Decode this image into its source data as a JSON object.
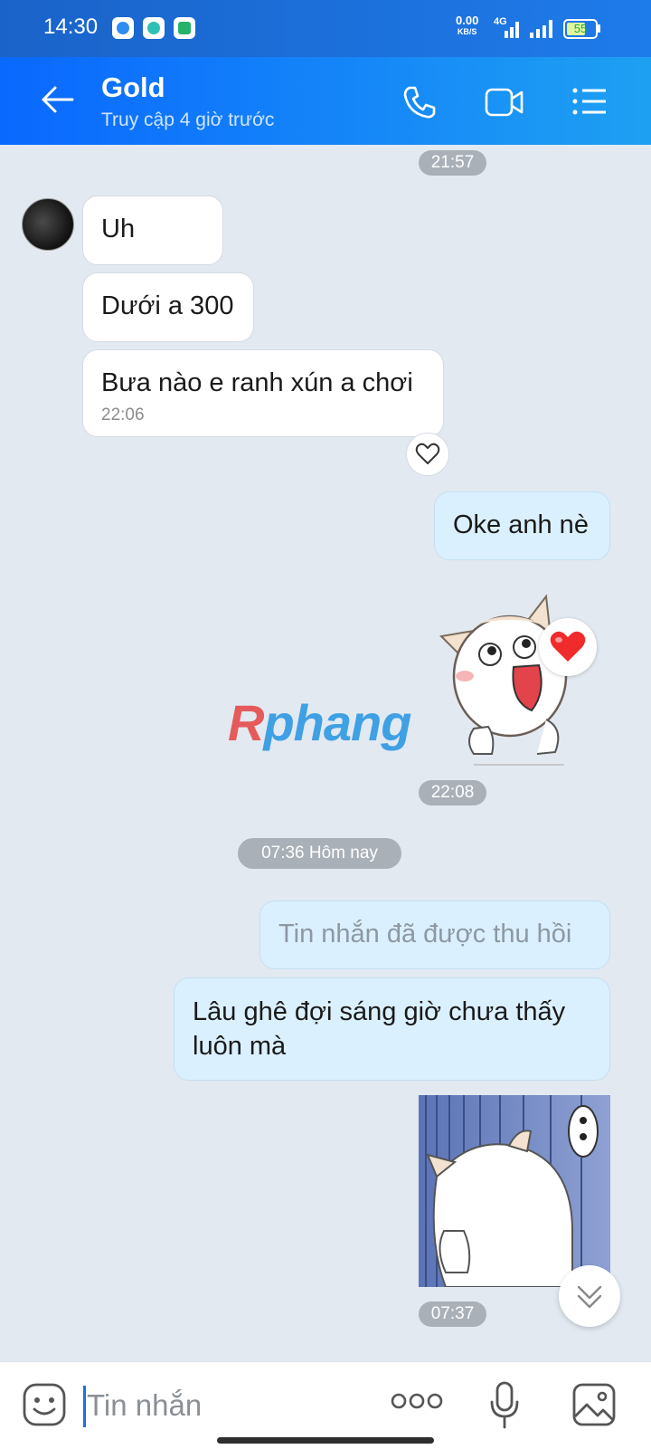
{
  "status_bar": {
    "time": "14:30",
    "net_speed_value": "0.00",
    "net_speed_unit": "KB/S",
    "network": "4G",
    "battery": "55"
  },
  "header": {
    "contact_name": "Gold",
    "contact_status": "Truy cập 4 giờ trước",
    "icons": [
      "back-arrow-icon",
      "phone-icon",
      "video-call-icon",
      "menu-list-icon"
    ]
  },
  "messages": {
    "time_divider_1": "21:57",
    "received_1": "Uh",
    "received_2": "Dưới a 300",
    "received_3": "Bưa nào e ranh xún a chơi",
    "received_3_time": "22:06",
    "sent_1": "Oke anh nè",
    "sticker_1_time": "22:08",
    "date_divider": "07:36 Hôm nay",
    "recalled": "Tin nhắn đã được thu hồi",
    "sent_2": "Lâu ghê đợi sáng giờ chưa thấy luôn mà",
    "sticker_2_time": "07:37"
  },
  "watermark": {
    "part1": "R",
    "part2": "phang"
  },
  "input_bar": {
    "placeholder": "Tin nhắn",
    "icons": [
      "sticker-icon",
      "more-options-icon",
      "microphone-icon",
      "gallery-icon"
    ]
  },
  "colors": {
    "header_start": "#0a68ff",
    "header_end": "#1ea0f2",
    "chat_bg": "#e2e9f1",
    "sent_bubble": "#dbf0fe",
    "received_bubble": "#ffffff"
  }
}
